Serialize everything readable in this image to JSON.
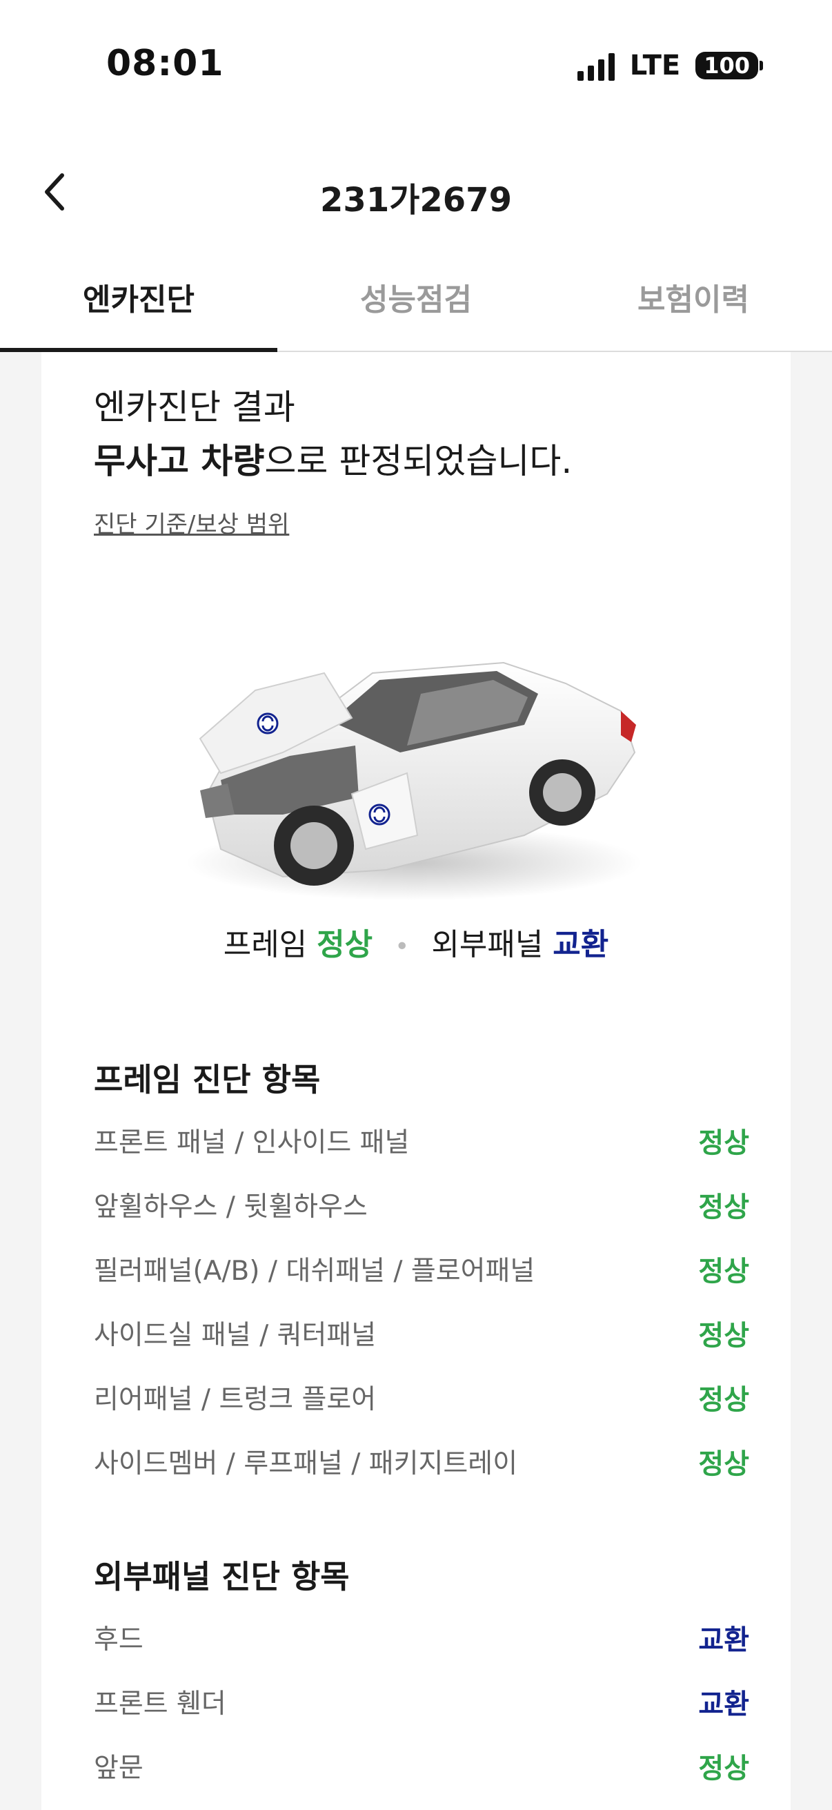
{
  "status_bar": {
    "time": "08:01",
    "network": "LTE",
    "battery": "100"
  },
  "header": {
    "title": "231가2679",
    "back_icon": "chevron-left-icon"
  },
  "tabs": [
    {
      "label": "엔카진단",
      "active": true
    },
    {
      "label": "성능점검",
      "active": false
    },
    {
      "label": "보험이력",
      "active": false
    }
  ],
  "result": {
    "line1": "엔카진단 결과",
    "line2_bold": "무사고 차량",
    "line2_rest": "으로 판정되었습니다.",
    "criteria_link": "진단 기준/보상 범위"
  },
  "summary": {
    "frame_label": "프레임",
    "frame_status": "정상",
    "panel_label": "외부패널",
    "panel_status": "교환"
  },
  "frame_section": {
    "title": "프레임 진단 항목",
    "items": [
      {
        "label": "프론트 패널 / 인사이드 패널",
        "status": "정상"
      },
      {
        "label": "앞휠하우스 / 뒷휠하우스",
        "status": "정상"
      },
      {
        "label": "필러패널(A/B) / 대쉬패널 / 플로어패널",
        "status": "정상"
      },
      {
        "label": "사이드실 패널 / 쿼터패널",
        "status": "정상"
      },
      {
        "label": "리어패널 / 트렁크 플로어",
        "status": "정상"
      },
      {
        "label": "사이드멤버 / 루프패널 / 패키지트레이",
        "status": "정상"
      }
    ]
  },
  "panel_section": {
    "title": "외부패널 진단 항목",
    "items": [
      {
        "label": "후드",
        "status": "교환"
      },
      {
        "label": "프론트 휀더",
        "status": "교환"
      },
      {
        "label": "앞문",
        "status": "정상"
      }
    ]
  },
  "colors": {
    "normal": "#2fa54a",
    "replaced": "#12238f"
  }
}
